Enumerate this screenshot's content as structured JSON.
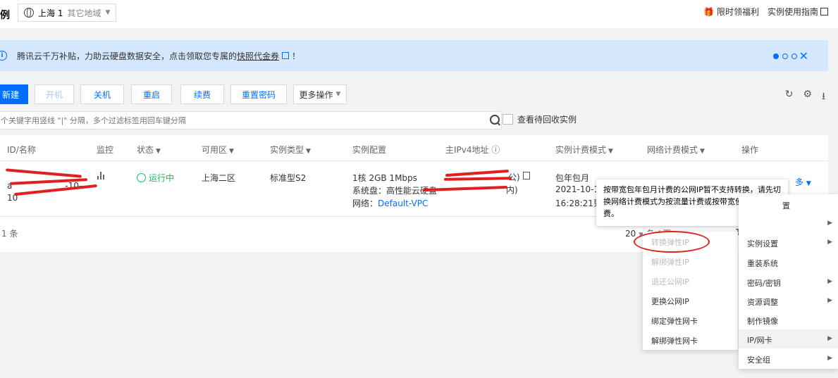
{
  "header": {
    "title_char": "例",
    "region_current": "上海 1",
    "region_other": "其它地域",
    "promo_link": "限时领福利",
    "guide_link": "实例使用指南"
  },
  "banner": {
    "text_before": "腾讯云千万补贴，力助云硬盘数据安全，点击领取您专属的",
    "link_text": "快照代金券",
    "text_after": "！"
  },
  "toolbar": {
    "new": "新建",
    "start": "开机",
    "stop": "关机",
    "restart": "重启",
    "renew": "续费",
    "reset_password": "重置密码",
    "more": "更多操作"
  },
  "search": {
    "placeholder": "个关键字用竖线 \"|\" 分隔，多个过滤标签用回车键分隔",
    "recycle_label": "查看待回收实例"
  },
  "table": {
    "headers": {
      "id": "ID/名称",
      "monitor": "监控",
      "status": "状态",
      "zone": "可用区",
      "type": "实例类型",
      "config": "实例配置",
      "ip": "主IPv4地址",
      "billing": "实例计费模式",
      "net_billing": "网络计费模式",
      "ops": "操作"
    },
    "row": {
      "id_line2": "a",
      "id_line3": "10",
      "id_suffix": "-10-",
      "status": "运行中",
      "zone": "上海二区",
      "type": "标准型S2",
      "config1": "1核 2GB 1Mbps",
      "config2": "系统盘：高性能云硬盘",
      "config3_label": "网络：",
      "config3_link": "Default-VPC",
      "ip_pub_suffix": "公)",
      "ip_priv_suffix": "内)",
      "billing1": "包年包月",
      "billing2": "2021-10-10",
      "billing3": "16:28:21到",
      "more": "多"
    },
    "footer_count": "1 条",
    "page_size": "20",
    "page_size_unit": "条 / 页",
    "page_num": "1"
  },
  "tooltip": {
    "text": "按带宽包年包月计费的公网IP暂不支持转换，请先切换网络计费模式为按流量计费或按带宽使用时长计费。"
  },
  "submenu": {
    "items": [
      "转换弹性IP",
      "解绑弹性IP",
      "退还公网IP",
      "更换公网IP",
      "绑定弹性网卡",
      "解绑弹性网卡"
    ]
  },
  "mainmenu": {
    "items": [
      "实例设置",
      "重装系统",
      "密码/密钥",
      "资源调整",
      "制作镜像",
      "IP/网卡",
      "安全组"
    ],
    "partial": "置"
  },
  "colors": {
    "accent": "#006eff",
    "running": "#0abf5b",
    "annotation": "#e02020"
  }
}
